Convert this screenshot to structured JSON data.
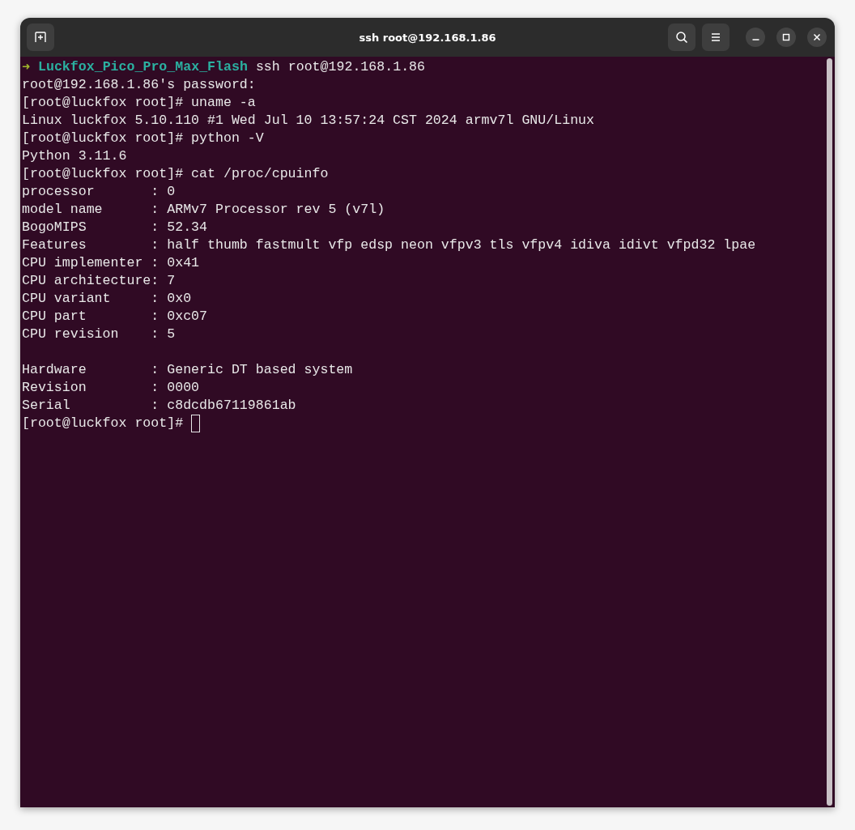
{
  "window": {
    "title": "ssh root@192.168.1.86"
  },
  "terminal": {
    "lines": [
      {
        "kind": "prompt",
        "arrow": "➜",
        "directory": "Luckfox_Pico_Pro_Max_Flash",
        "command": "ssh root@192.168.1.86"
      },
      {
        "kind": "text",
        "text": "root@192.168.1.86's password:"
      },
      {
        "kind": "text",
        "text": "[root@luckfox root]# uname -a"
      },
      {
        "kind": "text",
        "text": "Linux luckfox 5.10.110 #1 Wed Jul 10 13:57:24 CST 2024 armv7l GNU/Linux"
      },
      {
        "kind": "text",
        "text": "[root@luckfox root]# python -V"
      },
      {
        "kind": "text",
        "text": "Python 3.11.6"
      },
      {
        "kind": "text",
        "text": "[root@luckfox root]# cat /proc/cpuinfo"
      },
      {
        "kind": "text",
        "text": "processor       : 0"
      },
      {
        "kind": "text",
        "text": "model name      : ARMv7 Processor rev 5 (v7l)"
      },
      {
        "kind": "text",
        "text": "BogoMIPS        : 52.34"
      },
      {
        "kind": "text",
        "text": "Features        : half thumb fastmult vfp edsp neon vfpv3 tls vfpv4 idiva idivt vfpd32 lpae"
      },
      {
        "kind": "text",
        "text": "CPU implementer : 0x41"
      },
      {
        "kind": "text",
        "text": "CPU architecture: 7"
      },
      {
        "kind": "text",
        "text": "CPU variant     : 0x0"
      },
      {
        "kind": "text",
        "text": "CPU part        : 0xc07"
      },
      {
        "kind": "text",
        "text": "CPU revision    : 5"
      },
      {
        "kind": "blank"
      },
      {
        "kind": "text",
        "text": "Hardware        : Generic DT based system"
      },
      {
        "kind": "text",
        "text": "Revision        : 0000"
      },
      {
        "kind": "text",
        "text": "Serial          : c8dcdb67119861ab"
      },
      {
        "kind": "text",
        "text": "[root@luckfox root]#",
        "cursor": true
      }
    ]
  }
}
